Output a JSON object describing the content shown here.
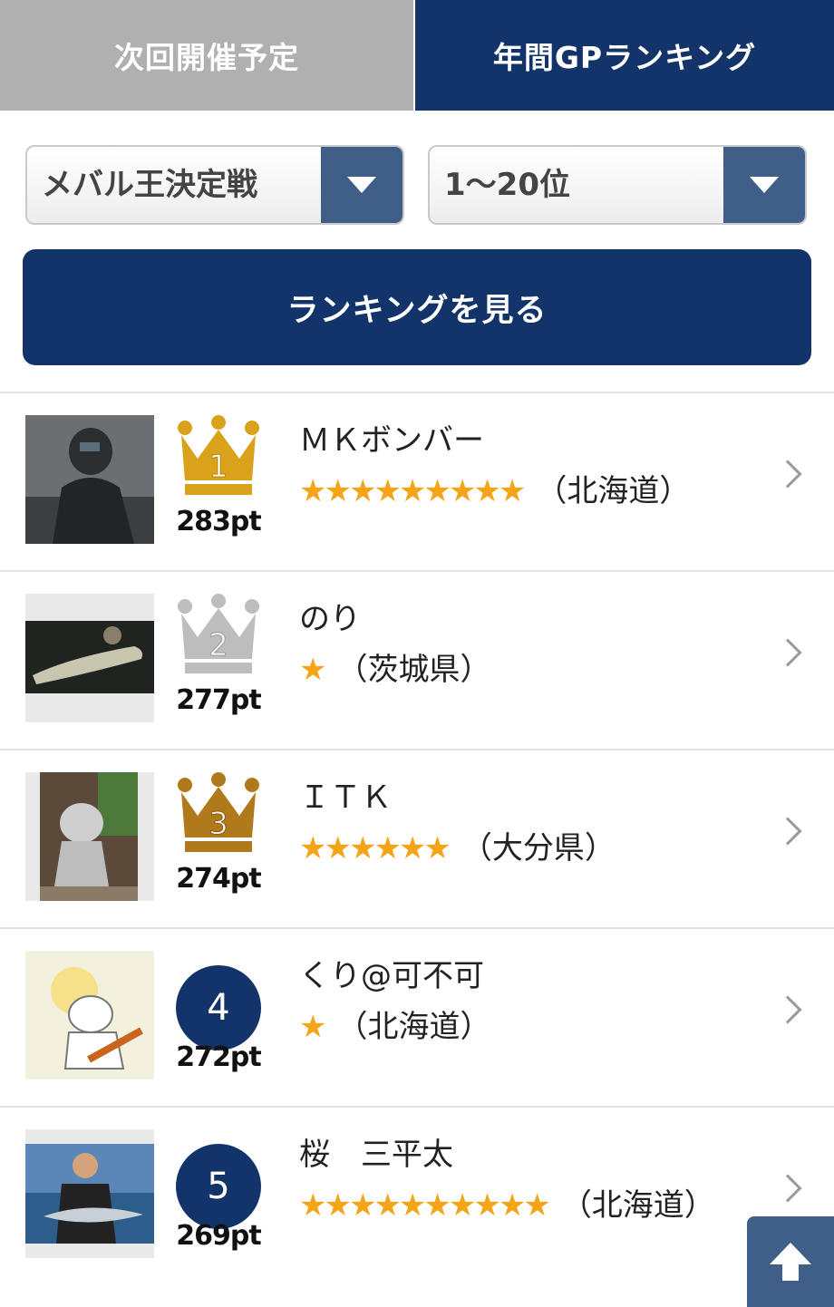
{
  "tabs": [
    {
      "label": "次回開催予定"
    },
    {
      "label": "年間GPランキング"
    }
  ],
  "filters": {
    "event_selected": "メバル王決定戦",
    "range_selected": "1〜20位"
  },
  "submit_label": "ランキングを見る",
  "colors": {
    "navy": "#13346a",
    "select_button": "#3f5f88",
    "gold": "#d9a21a",
    "silver": "#bdbdbd",
    "bronze": "#b07a1c",
    "star": "#f4a417"
  },
  "rankings": [
    {
      "rank": "1",
      "points": "283pt",
      "name": "ＭＫボンバー",
      "stars": "★★★★★★★★★",
      "region": "（北海道）",
      "badge": "gold-crown"
    },
    {
      "rank": "2",
      "points": "277pt",
      "name": "のり",
      "stars": "★",
      "region": "（茨城県）",
      "badge": "silver-crown"
    },
    {
      "rank": "3",
      "points": "274pt",
      "name": "ＩＴＫ",
      "stars": "★★★★★★",
      "region": "（大分県）",
      "badge": "bronze-crown"
    },
    {
      "rank": "4",
      "points": "272pt",
      "name": "くり@可不可",
      "stars": "★",
      "region": "（北海道）",
      "badge": "circle"
    },
    {
      "rank": "5",
      "points": "269pt",
      "name": "桜　三平太",
      "stars": "★★★★★★★★★★",
      "region": "（北海道）",
      "badge": "circle"
    }
  ],
  "icons": {
    "dropdown": "triangle-down-icon",
    "row_link": "chevron-right-icon",
    "back_to_top": "arrow-up-icon"
  }
}
